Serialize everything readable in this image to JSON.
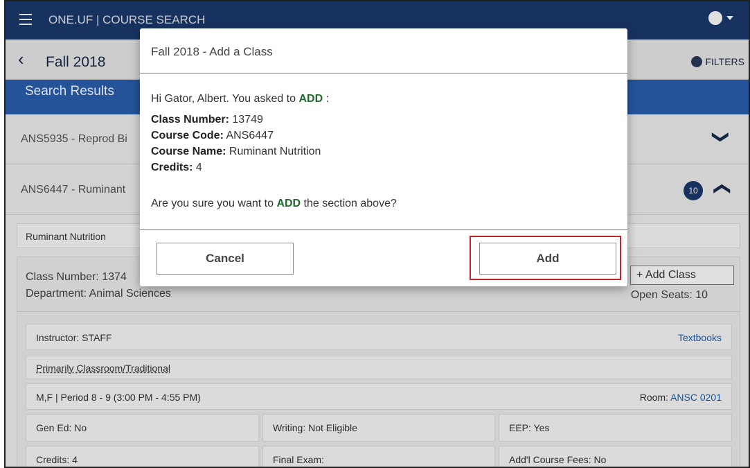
{
  "topbar": {
    "brand": "ONE.UF | COURSE SEARCH"
  },
  "subbar": {
    "term": "Fall 2018",
    "filters_label": "FILTERS"
  },
  "results": {
    "title": "Search Results"
  },
  "courses": [
    {
      "code": "ANS5935 - Reprod Bi",
      "chevron": "❯"
    },
    {
      "code": "ANS6447 - Ruminant",
      "count": "10"
    }
  ],
  "section": {
    "label": "Ruminant Nutrition",
    "class_number": "Class Number: 1374",
    "department": "Department: Animal Sciences",
    "add_class": "+ Add Class",
    "open_seats": "Open Seats: 10",
    "instructor": "Instructor: STAFF",
    "textbooks": "Textbooks",
    "mode": "Primarily Classroom/Traditional",
    "schedule": "M,F | Period 8 - 9 (3:00 PM - 4:55 PM)",
    "room_label": "Room:",
    "room": "ANSC 0201",
    "gen_ed": "Gen Ed: No",
    "writing": "Writing: Not Eligible",
    "eep": "EEP: Yes",
    "credits": "Credits: 4",
    "final_exam": "Final Exam:",
    "fees": "Add'l Course Fees: No"
  },
  "modal": {
    "title": "Fall 2018 - Add a Class",
    "greeting_prefix": "Hi Gator, Albert.  You asked to ",
    "action": "ADD",
    "greeting_suffix": " :",
    "class_number_label": "Class Number:",
    "class_number": " 13749",
    "course_code_label": "Course Code:",
    "course_code": " ANS6447",
    "course_name_label": "Course Name:",
    "course_name": " Ruminant Nutrition",
    "credits_label": "Credits:",
    "credits": " 4",
    "confirm_prefix": "Are you sure you want to ",
    "confirm_suffix": " the section above?",
    "cancel_label": "Cancel",
    "add_label": "Add"
  },
  "colors": {
    "header": "#1c3a6e",
    "results_bar": "#2a5fb0",
    "action_green": "#1e6b2e",
    "highlight_red": "#c0232a"
  }
}
